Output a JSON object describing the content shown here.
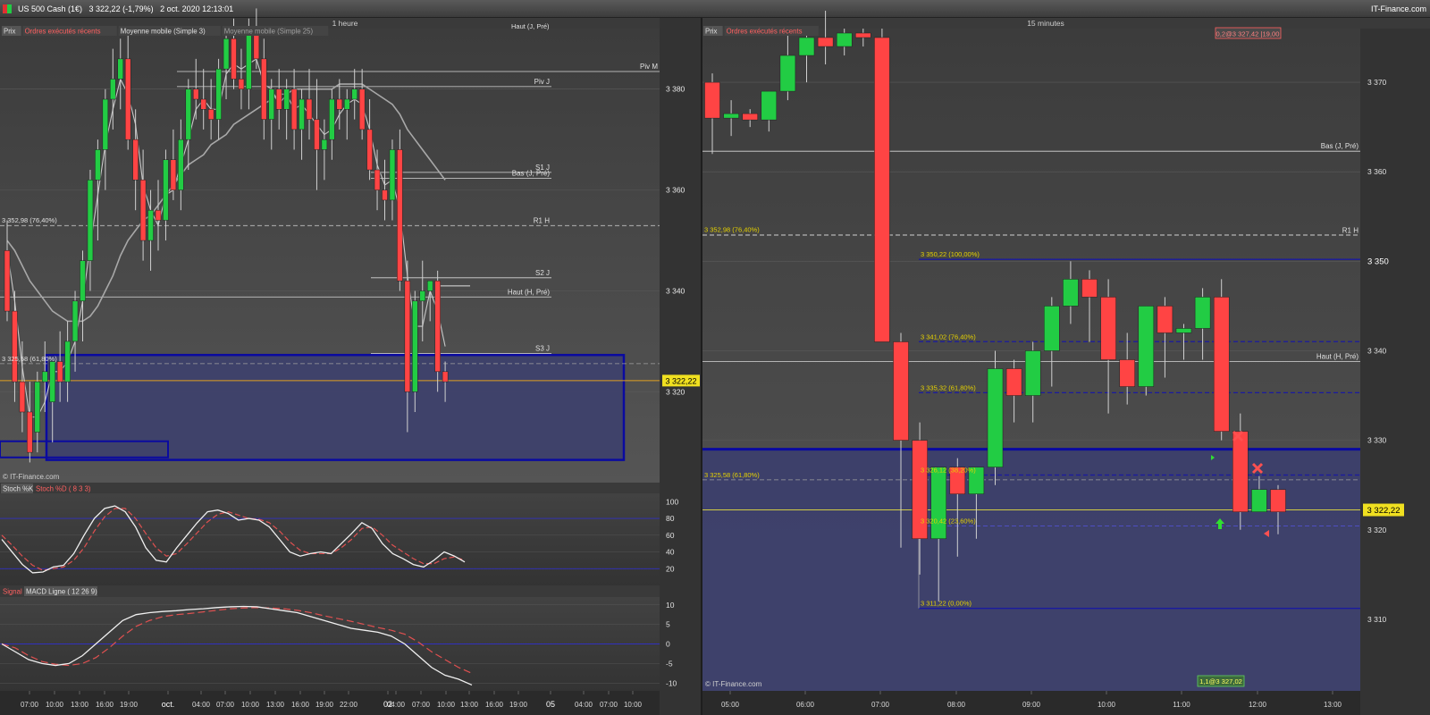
{
  "header": {
    "title": "US 500 Cash (1€)   3 322,22 (-1,79%)   2 oct. 2020 12:13:01",
    "brand": "IT-Finance.com"
  },
  "colors": {
    "bull": "#22cc44",
    "bear": "#ff4444",
    "zone_fill": "#3c3f6e",
    "zone_border": "#0a0aa0",
    "last_price_tag": "#f0e020",
    "fib_text": "#e6d200",
    "macd_signal": "#e05050"
  },
  "left_panel": {
    "timeframe": "1 heure",
    "legend": [
      "Prix",
      "Ordres exécutés récents",
      "Moyenne mobile (Simple 3)",
      "Moyenne mobile (Simple 25)"
    ],
    "watermark": "© IT-Finance.com",
    "top_cut_label": "Haut (J, Pré)",
    "level_lines": [
      {
        "label": "Piv M",
        "value": 3383.5
      },
      {
        "label": "Piv J",
        "value": 3380.5
      },
      {
        "label": "S1 J",
        "value": 3363.5
      },
      {
        "label": "Bas (J, Pré)",
        "value": 3362.3
      },
      {
        "label": "R1 H",
        "value": 3352.9
      },
      {
        "label": "S2 J",
        "value": 3342.6
      },
      {
        "label": "Haut (H, Pré)",
        "value": 3338.8
      },
      {
        "label": "S3 J",
        "value": 3327.6
      }
    ],
    "fib_labels": [
      {
        "label": "3 352,98 (76,40%)",
        "value": 3352.98
      },
      {
        "label": "3 325,58 (61,80%)",
        "value": 3325.58
      }
    ],
    "last_price_label": "3 322,22",
    "last_price": 3322.22,
    "time_labels": [
      "07:00",
      "10:00",
      "13:00",
      "16:00",
      "19:00",
      "oct.",
      "04:00",
      "07:00",
      "10:00",
      "13:00",
      "16:00",
      "19:00",
      "22:00",
      "02",
      "04:00",
      "07:00",
      "10:00",
      "13:00",
      "16:00",
      "19:00",
      "05",
      "04:00",
      "07:00",
      "10:00"
    ],
    "price_ticks": [
      "3 380",
      "3 360",
      "3 340",
      "3 320"
    ]
  },
  "stoch_panel": {
    "legend": [
      "Stoch %K",
      "Stoch %D ( 8 3 3)"
    ],
    "ticks": [
      "100",
      "80",
      "60",
      "40",
      "20"
    ]
  },
  "macd_panel": {
    "legend": [
      "Signal",
      "MACD Ligne ( 12 26 9)"
    ],
    "ticks": [
      "10",
      "5",
      "0",
      "-5",
      "-10"
    ]
  },
  "right_panel": {
    "timeframe": "15 minutes",
    "legend": [
      "Prix",
      "Ordres exécutés récents"
    ],
    "watermark": "© IT-Finance.com",
    "order_label_top": "0,2@3 327,42 |19,00",
    "order_label_bottom": "1,1@3 327,02",
    "last_price_label": "3 322,22",
    "last_price": 3322.22,
    "level_lines": [
      {
        "label": "Bas (J, Pré)",
        "value": 3362.3
      },
      {
        "label": "R1 H",
        "value": 3352.9
      },
      {
        "label": "Haut (H, Pré)",
        "value": 3338.8
      }
    ],
    "fib_labels": [
      {
        "label": "3 352,98 (76,40%)",
        "value": 3352.98
      },
      {
        "label": "3 350,22 (100,00%)",
        "value": 3350.22
      },
      {
        "label": "3 341,02 (76,40%)",
        "value": 3341.02
      },
      {
        "label": "3 335,32 (61,80%)",
        "value": 3335.32
      },
      {
        "label": "3 325,58 (61,80%)",
        "value": 3325.58
      },
      {
        "label": "3 326,12 (38,20%)",
        "value": 3326.12
      },
      {
        "label": "3 320,42 (23,60%)",
        "value": 3320.42
      },
      {
        "label": "3 311,22 (0,00%)",
        "value": 3311.22
      }
    ],
    "time_labels": [
      "05:00",
      "06:00",
      "07:00",
      "08:00",
      "09:00",
      "10:00",
      "11:00",
      "12:00",
      "13:00"
    ],
    "price_ticks": [
      "3 370",
      "3 360",
      "3 350",
      "3 340",
      "3 330",
      "3 320",
      "3 310"
    ]
  },
  "chart_data": [
    {
      "type": "candlestick",
      "title": "1 heure",
      "ylim": [
        3302,
        3392
      ],
      "x_step": "1h",
      "candles": [
        [
          3348,
          3354,
          3334,
          3336
        ],
        [
          3336,
          3340,
          3318,
          3322
        ],
        [
          3322,
          3330,
          3312,
          3316
        ],
        [
          3316,
          3322,
          3306,
          3308
        ],
        [
          3312,
          3324,
          3308,
          3322
        ],
        [
          3322,
          3330,
          3316,
          3324
        ],
        [
          3318,
          3326,
          3310,
          3326
        ],
        [
          3326,
          3332,
          3318,
          3322
        ],
        [
          3322,
          3334,
          3318,
          3330
        ],
        [
          3330,
          3340,
          3324,
          3338
        ],
        [
          3338,
          3348,
          3330,
          3346
        ],
        [
          3346,
          3364,
          3340,
          3362
        ],
        [
          3362,
          3370,
          3350,
          3368
        ],
        [
          3368,
          3380,
          3360,
          3378
        ],
        [
          3378,
          3388,
          3372,
          3382
        ],
        [
          3382,
          3390,
          3376,
          3386
        ],
        [
          3386,
          3392,
          3368,
          3370
        ],
        [
          3370,
          3376,
          3356,
          3362
        ],
        [
          3362,
          3368,
          3346,
          3350
        ],
        [
          3350,
          3360,
          3344,
          3356
        ],
        [
          3356,
          3362,
          3348,
          3354
        ],
        [
          3354,
          3368,
          3350,
          3366
        ],
        [
          3366,
          3372,
          3358,
          3360
        ],
        [
          3360,
          3374,
          3356,
          3370
        ],
        [
          3370,
          3382,
          3364,
          3380
        ],
        [
          3380,
          3386,
          3374,
          3378
        ],
        [
          3378,
          3384,
          3372,
          3376
        ],
        [
          3376,
          3382,
          3370,
          3374
        ],
        [
          3374,
          3386,
          3370,
          3384
        ],
        [
          3384,
          3392,
          3378,
          3390
        ],
        [
          3390,
          3394,
          3380,
          3382
        ],
        [
          3382,
          3388,
          3376,
          3380
        ],
        [
          3380,
          3394,
          3376,
          3392
        ],
        [
          3392,
          3396,
          3384,
          3386
        ],
        [
          3386,
          3390,
          3370,
          3374
        ],
        [
          3374,
          3382,
          3368,
          3380
        ],
        [
          3380,
          3384,
          3372,
          3376
        ],
        [
          3376,
          3382,
          3370,
          3380
        ],
        [
          3380,
          3384,
          3368,
          3372
        ],
        [
          3372,
          3380,
          3366,
          3378
        ],
        [
          3378,
          3384,
          3370,
          3374
        ],
        [
          3374,
          3382,
          3360,
          3368
        ],
        [
          3368,
          3374,
          3362,
          3370
        ],
        [
          3370,
          3380,
          3366,
          3378
        ],
        [
          3378,
          3382,
          3372,
          3376
        ],
        [
          3376,
          3380,
          3370,
          3378
        ],
        [
          3378,
          3384,
          3374,
          3380
        ],
        [
          3380,
          3384,
          3370,
          3372
        ],
        [
          3372,
          3378,
          3362,
          3364
        ],
        [
          3364,
          3368,
          3356,
          3360
        ],
        [
          3360,
          3366,
          3354,
          3358
        ],
        [
          3358,
          3370,
          3354,
          3368
        ],
        [
          3368,
          3372,
          3340,
          3342
        ],
        [
          3342,
          3346,
          3312,
          3320
        ],
        [
          3320,
          3340,
          3316,
          3338
        ],
        [
          3338,
          3346,
          3330,
          3340
        ],
        [
          3340,
          3342,
          3334,
          3342
        ],
        [
          3342,
          3344,
          3320,
          3324
        ],
        [
          3324,
          3326,
          3318,
          3322
        ]
      ],
      "sma3": [
        3348,
        3338,
        3325,
        3315,
        3315,
        3318,
        3324,
        3324,
        3326,
        3330,
        3338,
        3349,
        3359,
        3369,
        3376,
        3382,
        3379,
        3373,
        3361,
        3356,
        3353,
        3359,
        3360,
        3365,
        3370,
        3376,
        3378,
        3376,
        3376,
        3383,
        3385,
        3384,
        3385,
        3386,
        3381,
        3380,
        3377,
        3379,
        3376,
        3377,
        3375,
        3373,
        3371,
        3372,
        3375,
        3377,
        3378,
        3377,
        3372,
        3365,
        3361,
        3362,
        3356,
        3343,
        3333,
        3333,
        3340,
        3336,
        3329
      ],
      "sma25": [
        3350,
        3348,
        3345,
        3342,
        3340,
        3338,
        3336,
        3335,
        3334,
        3334,
        3334,
        3335,
        3337,
        3340,
        3343,
        3347,
        3350,
        3352,
        3354,
        3355,
        3357,
        3359,
        3361,
        3363,
        3365,
        3366,
        3367,
        3369,
        3370,
        3371,
        3373,
        3374,
        3375,
        3376,
        3377,
        3378,
        3379,
        3379,
        3380,
        3380,
        3380,
        3380,
        3380,
        3380,
        3381,
        3381,
        3381,
        3381,
        3380,
        3379,
        3378,
        3377,
        3375,
        3372,
        3370,
        3368,
        3366,
        3364,
        3362
      ]
    },
    {
      "type": "line",
      "title": "Stoch %K / Stoch %D ( 8 3 3)",
      "ylim": [
        0,
        110
      ],
      "series": [
        {
          "name": "Stoch %K",
          "values": [
            55,
            40,
            25,
            15,
            16,
            22,
            24,
            38,
            60,
            80,
            92,
            95,
            88,
            70,
            45,
            30,
            28,
            45,
            60,
            75,
            88,
            90,
            86,
            78,
            80,
            78,
            70,
            55,
            40,
            35,
            38,
            40,
            38,
            50,
            62,
            75,
            68,
            50,
            38,
            32,
            25,
            22,
            30,
            40,
            35,
            28
          ]
        },
        {
          "name": "Stoch %D ( 8 3 3)",
          "values": [
            60,
            48,
            35,
            24,
            18,
            20,
            22,
            30,
            45,
            65,
            82,
            92,
            92,
            80,
            62,
            45,
            35,
            38,
            50,
            63,
            76,
            85,
            88,
            84,
            80,
            79,
            75,
            65,
            52,
            42,
            38,
            38,
            38,
            45,
            55,
            68,
            70,
            60,
            48,
            40,
            32,
            26,
            26,
            32,
            34,
            30
          ]
        }
      ]
    },
    {
      "type": "line",
      "title": "Signal / MACD Ligne ( 12 26 9)",
      "ylim": [
        -12,
        12
      ],
      "series": [
        {
          "name": "MACD Ligne ( 12 26 9)",
          "values": [
            0,
            -2,
            -4,
            -5,
            -5.5,
            -5,
            -3,
            0,
            3,
            6,
            7.5,
            8,
            8.3,
            8.5,
            8.8,
            9,
            9.3,
            9.5,
            9.6,
            9.5,
            9,
            8.5,
            8,
            7,
            6,
            5,
            4,
            3.5,
            3,
            2,
            0,
            -3,
            -6,
            -8,
            -9,
            -10.5
          ]
        },
        {
          "name": "Signal",
          "values": [
            0,
            -1,
            -3,
            -4.5,
            -5.2,
            -5.5,
            -5,
            -3.5,
            -1,
            2,
            4.5,
            6,
            7,
            7.5,
            7.8,
            8.2,
            8.6,
            9,
            9.2,
            9.3,
            9.2,
            9,
            8.6,
            8,
            7.2,
            6.5,
            5.8,
            5,
            4.2,
            3.5,
            2.5,
            0.5,
            -2,
            -4,
            -6,
            -7.5
          ]
        }
      ]
    },
    {
      "type": "candlestick",
      "title": "15 minutes",
      "ylim": [
        3302,
        3376
      ],
      "x": [
        "05:00",
        "06:00",
        "07:00",
        "08:00",
        "09:00",
        "10:00",
        "11:00",
        "12:00",
        "13:00"
      ],
      "candles": [
        [
          3370,
          3371,
          3362,
          3366
        ],
        [
          3366,
          3368,
          3364,
          3366.5
        ],
        [
          3366.5,
          3367,
          3365,
          3365.8
        ],
        [
          3365.8,
          3369,
          3364.5,
          3369
        ],
        [
          3369,
          3376,
          3368,
          3373
        ],
        [
          3373,
          3376,
          3370,
          3375
        ],
        [
          3375,
          3378,
          3372,
          3374
        ],
        [
          3374,
          3376,
          3373,
          3375.5
        ],
        [
          3375.5,
          3376,
          3374,
          3375
        ],
        [
          3375,
          3376,
          3342,
          3341
        ],
        [
          3341,
          3342,
          3318,
          3330
        ],
        [
          3330,
          3332,
          3315,
          3319
        ],
        [
          3319,
          3327,
          3312,
          3327
        ],
        [
          3327,
          3328,
          3317,
          3324
        ],
        [
          3324,
          3327,
          3319,
          3327
        ],
        [
          3327,
          3340,
          3325,
          3338
        ],
        [
          3338,
          3339,
          3332,
          3335
        ],
        [
          3335,
          3341,
          3332,
          3340
        ],
        [
          3340,
          3346,
          3336,
          3345
        ],
        [
          3345,
          3350,
          3343,
          3348
        ],
        [
          3348,
          3349,
          3341,
          3346
        ],
        [
          3346,
          3348,
          3333,
          3339
        ],
        [
          3339,
          3342,
          3334,
          3336
        ],
        [
          3336,
          3345,
          3335,
          3345
        ],
        [
          3345,
          3346,
          3337,
          3342
        ],
        [
          3342,
          3343,
          3339,
          3342.5
        ],
        [
          3342.5,
          3347,
          3339,
          3346
        ],
        [
          3346,
          3348,
          3330,
          3331
        ],
        [
          3331,
          3333,
          3320,
          3322
        ],
        [
          3322,
          3326,
          3322,
          3324.5
        ],
        [
          3324.5,
          3325,
          3319.5,
          3322
        ]
      ]
    }
  ]
}
